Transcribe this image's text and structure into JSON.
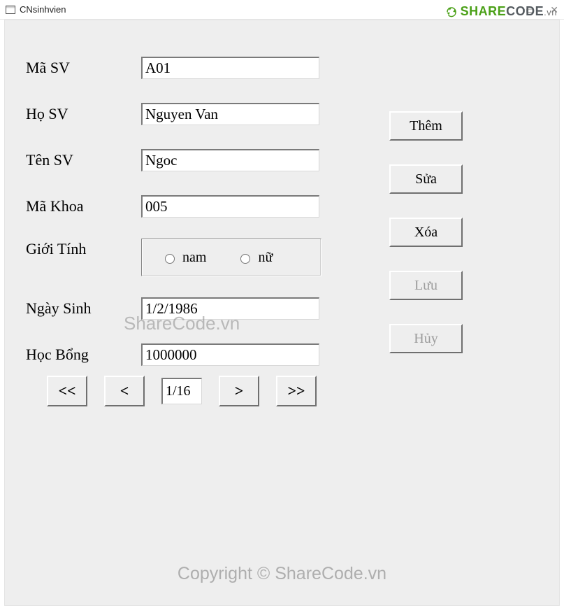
{
  "window": {
    "title": "CNsinhvien"
  },
  "branding": {
    "logo_share": "SHARE",
    "logo_code": "CODE",
    "logo_tld": ".vn",
    "watermark_mid": "ShareCode.vn",
    "copyright": "Copyright © ShareCode.vn"
  },
  "labels": {
    "masv": "Mã SV",
    "hosv": "Họ SV",
    "tensv": "Tên SV",
    "makhoa": "Mã Khoa",
    "gioitinh": "Giới Tính",
    "ngaysinh": "Ngày Sinh",
    "hocbong": "Học Bổng",
    "nam": "nam",
    "nu": "nữ"
  },
  "values": {
    "masv": "A01",
    "hosv": "Nguyen Van",
    "tensv": "Ngoc",
    "makhoa": "005",
    "ngaysinh": "1/2/1986",
    "hocbong": "1000000",
    "page": "1/16",
    "gender_selected": ""
  },
  "buttons": {
    "them": "Thêm",
    "sua": "Sửa",
    "xoa": "Xóa",
    "luu": "Lưu",
    "huy": "Hủy",
    "first": "<<",
    "prev": "<",
    "next": ">",
    "last": ">>"
  }
}
